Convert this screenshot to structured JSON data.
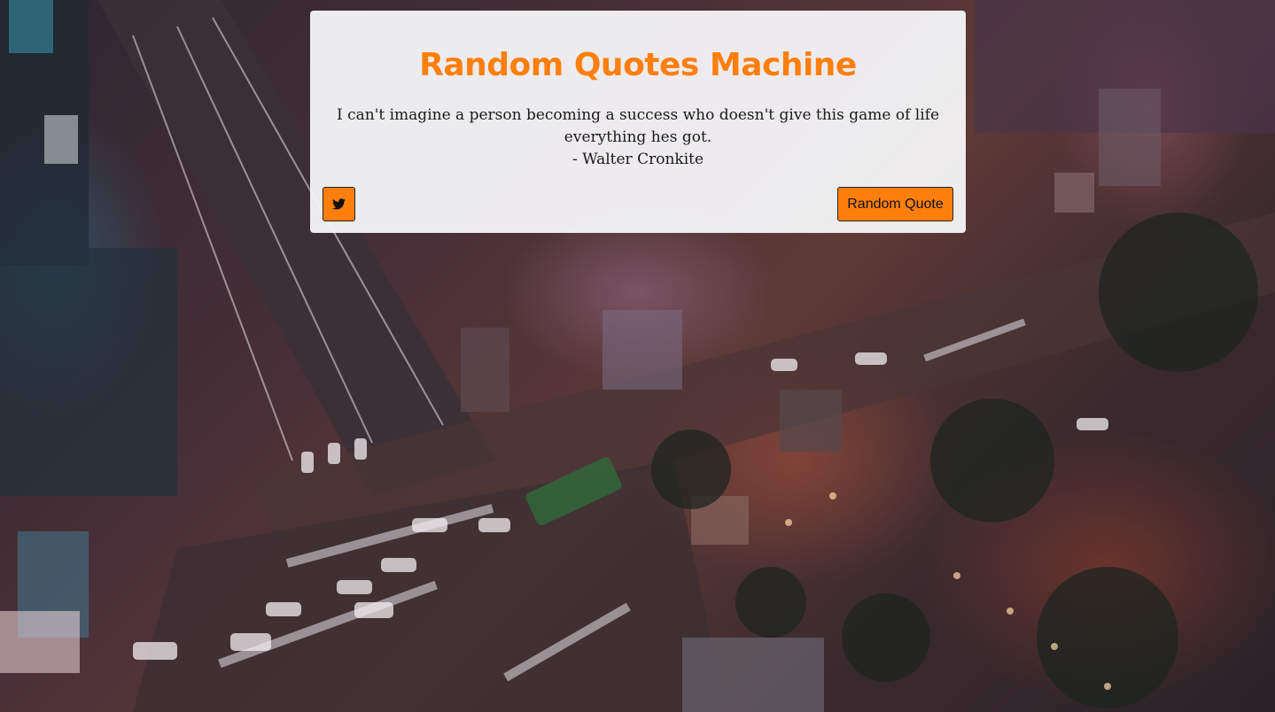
{
  "app": {
    "title": "Random Quotes Machine",
    "accent_color": "#ff7f0e"
  },
  "quote": {
    "text": "I can't imagine a person becoming a success who doesn't give this game of life everything hes got.",
    "author": "- Walter Cronkite"
  },
  "actions": {
    "tweet_icon": "twitter-icon",
    "new_quote_label": "Random Quote"
  },
  "background": {
    "description_icon": "city-intersection-night-photo"
  }
}
